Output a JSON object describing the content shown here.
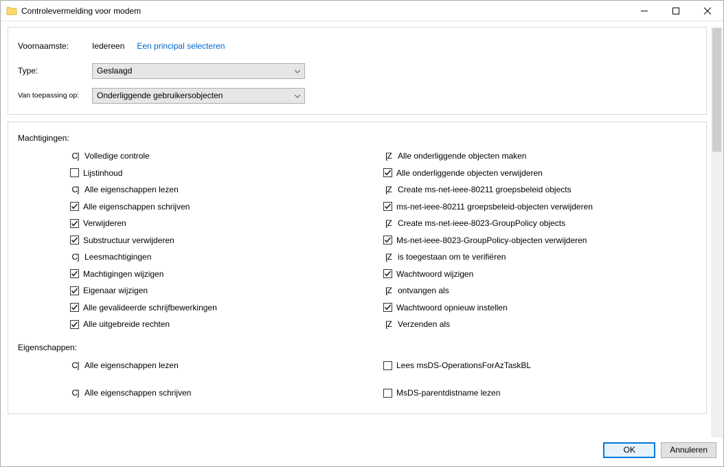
{
  "window": {
    "title": "Controlevermelding voor modem"
  },
  "header": {
    "principal_label": "Voornaamste:",
    "principal_value": "Iedereen",
    "select_principal_link": "Een principal selecteren",
    "type_label": "Type:",
    "type_value": "Geslaagd",
    "applies_label": "Van toepassing op:",
    "applies_value": "Onderliggende gebruikersobjecten"
  },
  "sections": {
    "permissions_title": "Machtigingen:",
    "properties_title": "Eigenschappen:"
  },
  "permissions_left": [
    {
      "state": "glyph_c",
      "label": "Volledige controle"
    },
    {
      "state": "unchecked",
      "label": "Lijstinhoud"
    },
    {
      "state": "glyph_c",
      "label": "Alle eigenschappen lezen"
    },
    {
      "state": "checked",
      "label": "Alle eigenschappen schrijven"
    },
    {
      "state": "checked",
      "label": "Verwijderen"
    },
    {
      "state": "checked",
      "label": "Substructuur verwijderen"
    },
    {
      "state": "glyph_c",
      "label": "Leesmachtigingen"
    },
    {
      "state": "checked",
      "label": "Machtigingen wijzigen"
    },
    {
      "state": "checked",
      "label": "Eigenaar wijzigen"
    },
    {
      "state": "checked",
      "label": "Alle gevalideerde schrijfbewerkingen"
    },
    {
      "state": "checked",
      "label": "Alle uitgebreide rechten"
    }
  ],
  "permissions_right": [
    {
      "state": "glyph_z",
      "label": "Alle onderliggende objecten maken"
    },
    {
      "state": "checked",
      "label": "Alle onderliggende objecten verwijderen"
    },
    {
      "state": "glyph_z",
      "label": "Create ms-net-ieee-80211 groepsbeleid objects"
    },
    {
      "state": "checked",
      "label": "ms-net-ieee-80211 groepsbeleid-objecten verwijderen"
    },
    {
      "state": "glyph_z",
      "label": "Create ms-net-ieee-8023-GroupPolicy objects"
    },
    {
      "state": "checked",
      "label": "Ms-net-ieee-8023-GroupPolicy-objecten verwijderen"
    },
    {
      "state": "glyph_z",
      "label": "is toegestaan om te verifiëren"
    },
    {
      "state": "checked",
      "label": "Wachtwoord wijzigen"
    },
    {
      "state": "glyph_z",
      "label": "ontvangen als"
    },
    {
      "state": "checked",
      "label": "Wachtwoord opnieuw instellen"
    },
    {
      "state": "glyph_z",
      "label": "Verzenden als"
    }
  ],
  "properties_left": [
    {
      "state": "glyph_c",
      "label": "Alle eigenschappen lezen"
    },
    {
      "state": "glyph_c",
      "label": "Alle eigenschappen schrijven"
    }
  ],
  "properties_right": [
    {
      "state": "unchecked",
      "label": "Lees msDS-OperationsForAzTaskBL"
    },
    {
      "state": "unchecked",
      "label": "MsDS-parentdistname lezen"
    }
  ],
  "footer": {
    "ok": "OK",
    "cancel": "Annuleren"
  }
}
